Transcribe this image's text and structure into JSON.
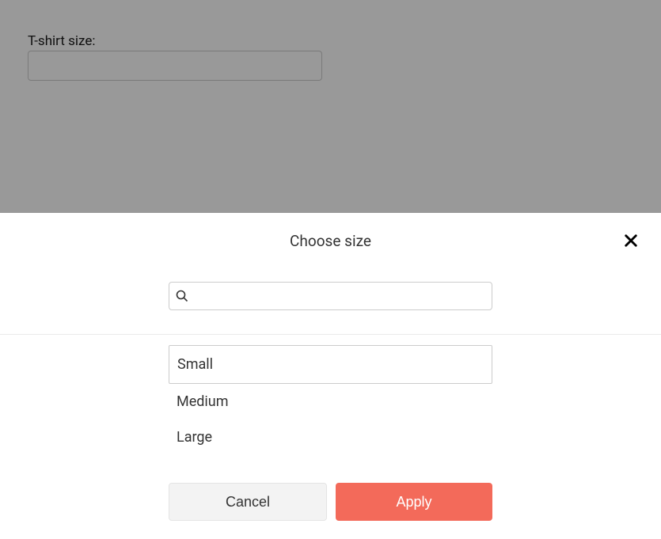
{
  "form": {
    "field_label": "T-shirt size:",
    "field_value": ""
  },
  "sheet": {
    "title": "Choose size",
    "search_value": "",
    "options": [
      {
        "label": "Small",
        "selected": true
      },
      {
        "label": "Medium",
        "selected": false
      },
      {
        "label": "Large",
        "selected": false
      }
    ],
    "cancel_label": "Cancel",
    "apply_label": "Apply"
  },
  "colors": {
    "primary": "#f36a5a"
  }
}
